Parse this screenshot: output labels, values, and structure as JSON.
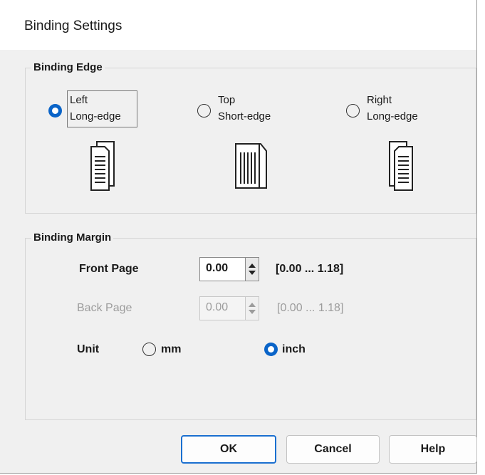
{
  "dialog": {
    "title": "Binding Settings"
  },
  "binding_edge": {
    "legend": "Binding Edge",
    "options": [
      {
        "line1": "Left",
        "line2": "Long-edge",
        "selected": true,
        "icon": "page-stack-left-icon"
      },
      {
        "line1": "Top",
        "line2": "Short-edge",
        "selected": false,
        "icon": "page-stack-top-icon"
      },
      {
        "line1": "Right",
        "line2": "Long-edge",
        "selected": false,
        "icon": "page-stack-right-icon"
      }
    ]
  },
  "binding_margin": {
    "legend": "Binding Margin",
    "front_page": {
      "label": "Front Page",
      "value": "0.00",
      "range": "[0.00 ... 1.18]",
      "enabled": true
    },
    "back_page": {
      "label": "Back Page",
      "value": "0.00",
      "range": "[0.00 ... 1.18]",
      "enabled": false
    },
    "unit": {
      "label": "Unit",
      "options": [
        {
          "label": "mm",
          "selected": false
        },
        {
          "label": "inch",
          "selected": true
        }
      ]
    }
  },
  "buttons": {
    "ok": "OK",
    "cancel": "Cancel",
    "help": "Help"
  },
  "colors": {
    "accent": "#0a64c8",
    "default_button_border": "#1a6fd0",
    "disabled_text": "#9c9c9c"
  }
}
